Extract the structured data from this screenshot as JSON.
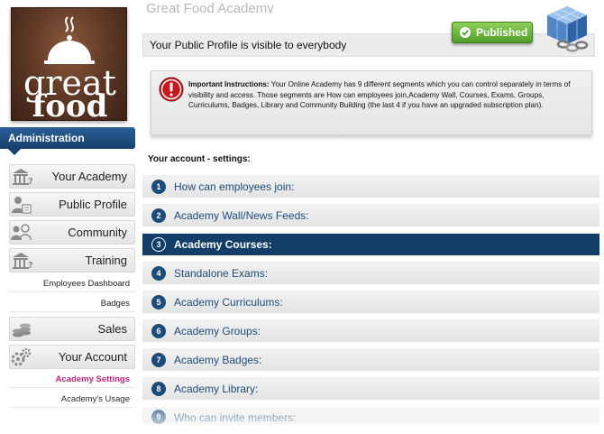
{
  "app": {
    "academy_name": "Great Food Academy"
  },
  "logo": {
    "line1": "great",
    "line2": "food"
  },
  "sidebar": {
    "header": "Administration",
    "items": [
      {
        "label": "Your Academy",
        "icon": "academy-building-icon"
      },
      {
        "label": "Public Profile",
        "icon": "profile-icon"
      },
      {
        "label": "Community",
        "icon": "community-icon"
      },
      {
        "label": "Training",
        "icon": "training-building-icon"
      },
      {
        "label": "Employees Dashboard",
        "sub": true
      },
      {
        "label": "Badges",
        "sub": true
      },
      {
        "label": "Sales",
        "icon": "coins-icon"
      },
      {
        "label": "Your Account",
        "icon": "gears-icon"
      },
      {
        "label": "Academy Settings",
        "sub": true,
        "active": true
      },
      {
        "label": "Academy's Usage",
        "sub": true
      }
    ]
  },
  "profile": {
    "status_text": "Your Public Profile is visible to everybody",
    "published_label": "Published"
  },
  "instructions": {
    "heading": "Important Instructions:",
    "body": " Your Online Academy has 9 different segments which you can control separately in terms of visibility and access. Those segments are How can employees join,Academy Wall, Courses, Exams, Groups, Curriculums, Badges, Library and Community Building (the last 4 if you have an upgraded subscription plan)."
  },
  "settings": {
    "title": "Your account - settings:",
    "segments": [
      {
        "num": "1",
        "label": "How can employees join:"
      },
      {
        "num": "2",
        "label": "Academy Wall/News Feeds:"
      },
      {
        "num": "3",
        "label": "Academy Courses:",
        "active": true
      },
      {
        "num": "4",
        "label": "Standalone Exams:"
      },
      {
        "num": "5",
        "label": "Academy Curriculums:"
      },
      {
        "num": "6",
        "label": "Academy Groups:"
      },
      {
        "num": "7",
        "label": "Academy Badges:"
      },
      {
        "num": "8",
        "label": "Academy Library:"
      },
      {
        "num": "9",
        "label": "Who can invite members:"
      }
    ]
  },
  "colors": {
    "accent_blue": "#133e68",
    "link_blue": "#1d4c7c",
    "published_green": "#4f9d27",
    "active_sub_magenta": "#b8247a",
    "alert_red": "#c8181e"
  }
}
